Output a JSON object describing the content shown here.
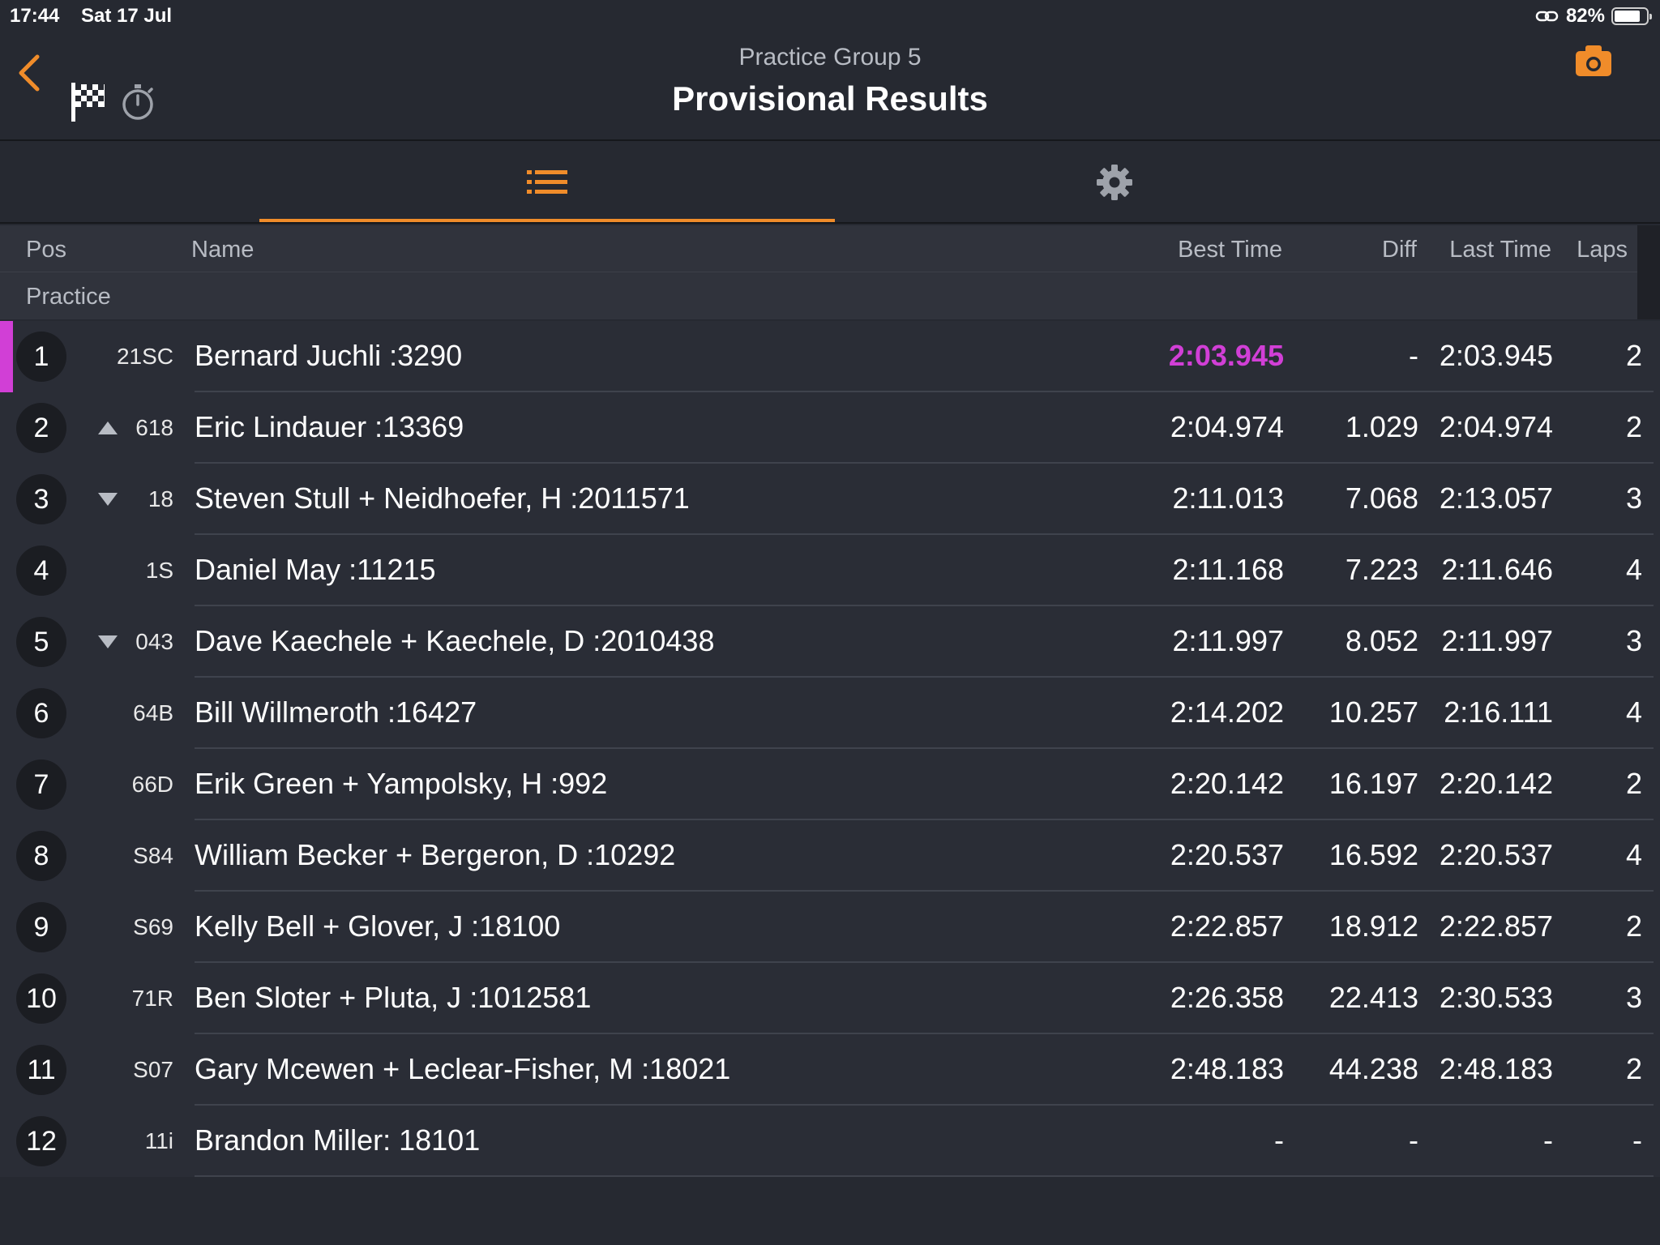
{
  "status_bar": {
    "time": "17:44",
    "date": "Sat 17 Jul",
    "battery_text": "82%",
    "battery_level": 0.82
  },
  "nav": {
    "subtitle": "Practice Group 5",
    "title": "Provisional Results",
    "icons": [
      "chevron-left-icon",
      "checkered-flag-icon",
      "stopwatch-icon",
      "camera-icon"
    ]
  },
  "tabs": [
    {
      "icon": "list-icon",
      "active": true
    },
    {
      "icon": "gear-icon",
      "active": false
    }
  ],
  "columns": {
    "pos": "Pos",
    "name": "Name",
    "best": "Best Time",
    "diff": "Diff",
    "last": "Last Time",
    "laps": "Laps"
  },
  "section_label": "Practice",
  "colors": {
    "accent": "#f08c2a",
    "fastest": "#d13fd6",
    "background": "#262931",
    "row": "#2a2d36"
  },
  "rows": [
    {
      "pos": "1",
      "num": "21SC",
      "name": "Bernard Juchli :3290",
      "best": "2:03.945",
      "diff": "-",
      "last": "2:03.945",
      "laps": "2",
      "change": "",
      "fastest": true
    },
    {
      "pos": "2",
      "num": "618",
      "name": "Eric Lindauer :13369",
      "best": "2:04.974",
      "diff": "1.029",
      "last": "2:04.974",
      "laps": "2",
      "change": "up",
      "fastest": false
    },
    {
      "pos": "3",
      "num": "18",
      "name": "Steven Stull + Neidhoefer, H :2011571",
      "best": "2:11.013",
      "diff": "7.068",
      "last": "2:13.057",
      "laps": "3",
      "change": "down",
      "fastest": false
    },
    {
      "pos": "4",
      "num": "1S",
      "name": "Daniel May :11215",
      "best": "2:11.168",
      "diff": "7.223",
      "last": "2:11.646",
      "laps": "4",
      "change": "",
      "fastest": false
    },
    {
      "pos": "5",
      "num": "043",
      "name": "Dave Kaechele + Kaechele, D :2010438",
      "best": "2:11.997",
      "diff": "8.052",
      "last": "2:11.997",
      "laps": "3",
      "change": "down",
      "fastest": false
    },
    {
      "pos": "6",
      "num": "64B",
      "name": "Bill Willmeroth :16427",
      "best": "2:14.202",
      "diff": "10.257",
      "last": "2:16.111",
      "laps": "4",
      "change": "",
      "fastest": false
    },
    {
      "pos": "7",
      "num": "66D",
      "name": "Erik Green + Yampolsky, H :992",
      "best": "2:20.142",
      "diff": "16.197",
      "last": "2:20.142",
      "laps": "2",
      "change": "",
      "fastest": false
    },
    {
      "pos": "8",
      "num": "S84",
      "name": "William Becker + Bergeron, D :10292",
      "best": "2:20.537",
      "diff": "16.592",
      "last": "2:20.537",
      "laps": "4",
      "change": "",
      "fastest": false
    },
    {
      "pos": "9",
      "num": "S69",
      "name": "Kelly Bell + Glover, J :18100",
      "best": "2:22.857",
      "diff": "18.912",
      "last": "2:22.857",
      "laps": "2",
      "change": "",
      "fastest": false
    },
    {
      "pos": "10",
      "num": "71R",
      "name": "Ben Sloter + Pluta, J :1012581",
      "best": "2:26.358",
      "diff": "22.413",
      "last": "2:30.533",
      "laps": "3",
      "change": "",
      "fastest": false
    },
    {
      "pos": "11",
      "num": "S07",
      "name": "Gary Mcewen + Leclear-Fisher, M :18021",
      "best": "2:48.183",
      "diff": "44.238",
      "last": "2:48.183",
      "laps": "2",
      "change": "",
      "fastest": false
    },
    {
      "pos": "12",
      "num": "11i",
      "name": "Brandon Miller: 18101",
      "best": "-",
      "diff": "-",
      "last": "-",
      "laps": "-",
      "change": "",
      "fastest": false
    }
  ]
}
